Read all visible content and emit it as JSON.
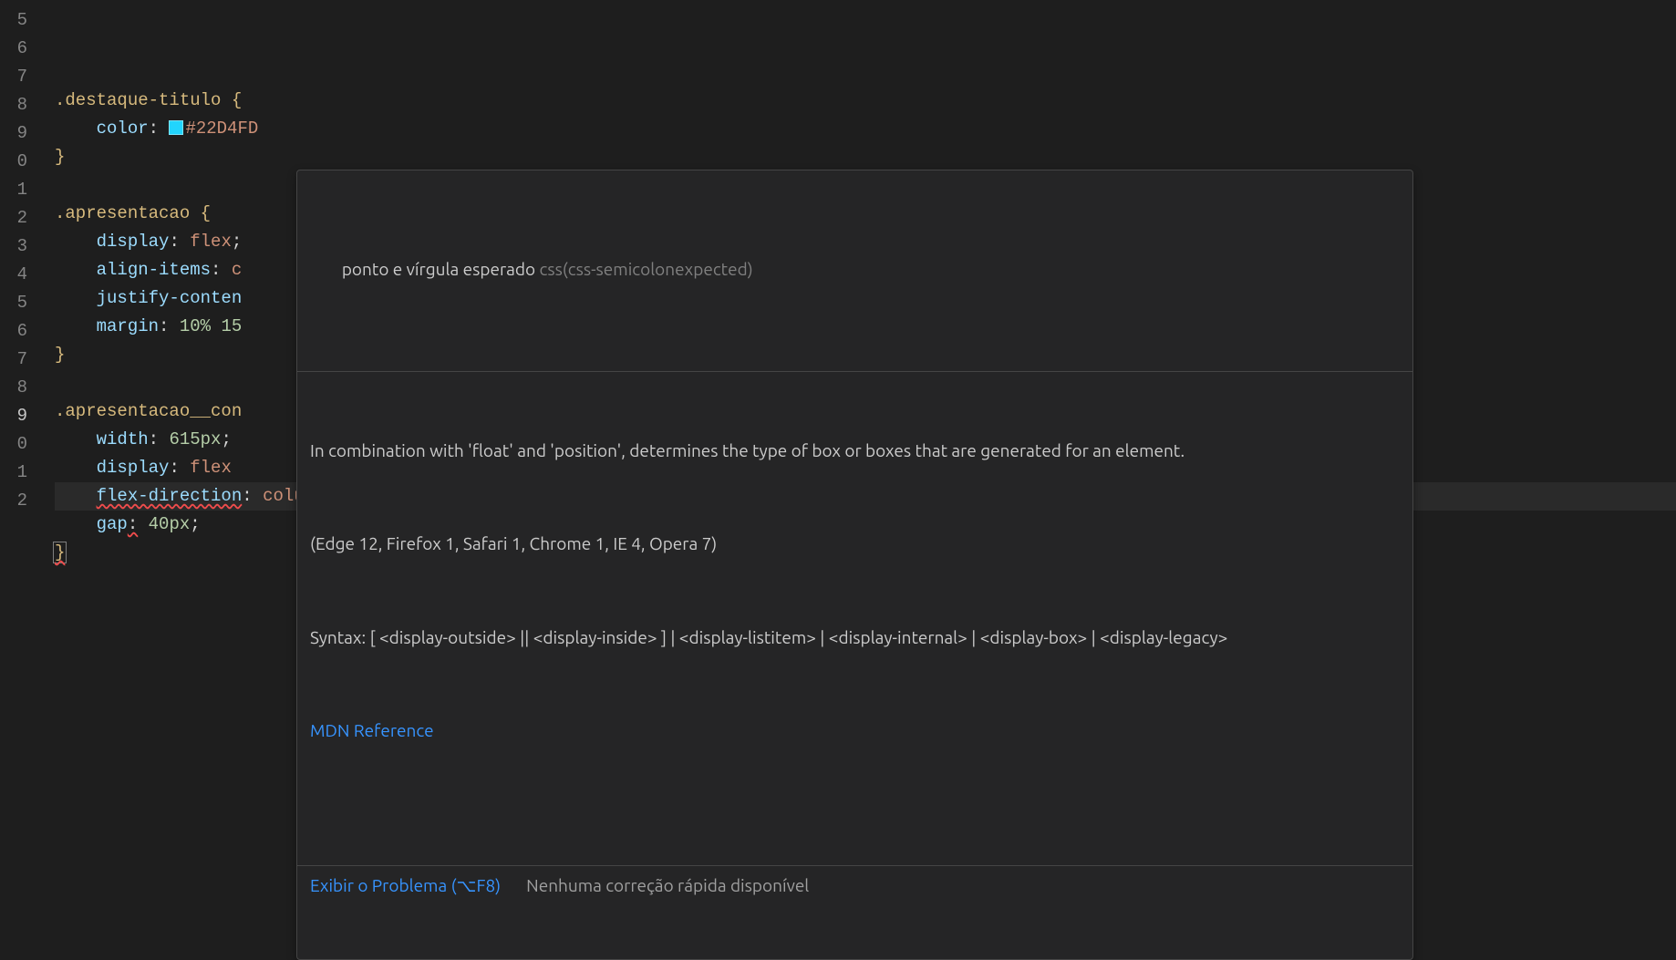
{
  "gutter": {
    "line_numbers": [
      "5",
      "6",
      "7",
      "8",
      "9",
      "0",
      "1",
      "2",
      "3",
      "4",
      "5",
      "6",
      "7",
      "8",
      "9",
      "0",
      "1",
      "2"
    ],
    "current_index": 14
  },
  "code": {
    "rows": [
      {
        "tokens": [
          {
            "t": ".destaque-titulo ",
            "c": "tk-selector"
          },
          {
            "t": "{",
            "c": "tk-brace"
          }
        ]
      },
      {
        "tokens": [
          {
            "t": "    ",
            "c": ""
          },
          {
            "t": "color",
            "c": "tk-prop"
          },
          {
            "t": ": ",
            "c": "tk-punc"
          },
          {
            "swatch": "#22D4FD"
          },
          {
            "t": "#22D4FD",
            "c": "tk-value"
          }
        ]
      },
      {
        "tokens": [
          {
            "t": "}",
            "c": "tk-brace"
          }
        ]
      },
      {
        "tokens": []
      },
      {
        "tokens": [
          {
            "t": ".apresentacao ",
            "c": "tk-selector"
          },
          {
            "t": "{",
            "c": "tk-brace"
          }
        ]
      },
      {
        "tokens": [
          {
            "t": "    ",
            "c": ""
          },
          {
            "t": "display",
            "c": "tk-prop"
          },
          {
            "t": ": ",
            "c": "tk-punc"
          },
          {
            "t": "flex",
            "c": "tk-value"
          },
          {
            "t": ";",
            "c": "tk-punc"
          }
        ]
      },
      {
        "tokens": [
          {
            "t": "    ",
            "c": ""
          },
          {
            "t": "align-items",
            "c": "tk-prop"
          },
          {
            "t": ": ",
            "c": "tk-punc"
          },
          {
            "t": "c",
            "c": "tk-value"
          }
        ]
      },
      {
        "tokens": [
          {
            "t": "    ",
            "c": ""
          },
          {
            "t": "justify-conten",
            "c": "tk-prop"
          }
        ]
      },
      {
        "tokens": [
          {
            "t": "    ",
            "c": ""
          },
          {
            "t": "margin",
            "c": "tk-prop"
          },
          {
            "t": ": ",
            "c": "tk-punc"
          },
          {
            "t": "10% 15",
            "c": "tk-num"
          }
        ]
      },
      {
        "tokens": [
          {
            "t": "}",
            "c": "tk-brace"
          }
        ]
      },
      {
        "tokens": []
      },
      {
        "tokens": [
          {
            "t": ".apresentacao__con",
            "c": "tk-selector"
          }
        ]
      },
      {
        "tokens": [
          {
            "t": "    ",
            "c": ""
          },
          {
            "t": "width",
            "c": "tk-prop"
          },
          {
            "t": ": ",
            "c": "tk-punc"
          },
          {
            "t": "615px",
            "c": "tk-num"
          },
          {
            "t": ";",
            "c": "tk-punc"
          }
        ]
      },
      {
        "tokens": [
          {
            "t": "    ",
            "c": ""
          },
          {
            "t": "display",
            "c": "tk-prop"
          },
          {
            "t": ": ",
            "c": "tk-punc"
          },
          {
            "t": "flex",
            "c": "tk-value"
          }
        ]
      },
      {
        "hl": true,
        "tokens": [
          {
            "t": "    ",
            "c": ""
          },
          {
            "t": "flex-direction",
            "c": "tk-prop",
            "squiggle": true
          },
          {
            "t": ": ",
            "c": "tk-punc"
          },
          {
            "t": "column",
            "c": "tk-value"
          },
          {
            "t": ";",
            "c": "tk-punc"
          }
        ]
      },
      {
        "tokens": [
          {
            "t": "    ",
            "c": ""
          },
          {
            "t": "gap",
            "c": "tk-prop"
          },
          {
            "t": ":",
            "c": "tk-punc",
            "squiggle": true
          },
          {
            "t": " ",
            "c": ""
          },
          {
            "t": "40px",
            "c": "tk-num"
          },
          {
            "t": ";",
            "c": "tk-punc"
          }
        ]
      },
      {
        "tokens": [
          {
            "t": "}",
            "c": "tk-brace",
            "bracebox": true,
            "squiggle": true
          }
        ]
      },
      {
        "tokens": []
      }
    ]
  },
  "hover": {
    "diagnostic_message": "ponto e vírgula esperado ",
    "diagnostic_code": "css(css-semicolonexpected)",
    "description": "In combination with 'float' and 'position', determines the type of box or boxes that are generated for an element.",
    "support": "(Edge 12, Firefox 1, Safari 1, Chrome 1, IE 4, Opera 7)",
    "syntax": "Syntax: [ <display-outside> || <display-inside> ] | <display-listitem> | <display-internal> | <display-box> | <display-legacy>",
    "mdn_label": "MDN Reference",
    "view_problem_label": "Exibir o Problema (⌥F8)",
    "no_quickfix_label": "Nenhuma correção rápida disponível"
  }
}
